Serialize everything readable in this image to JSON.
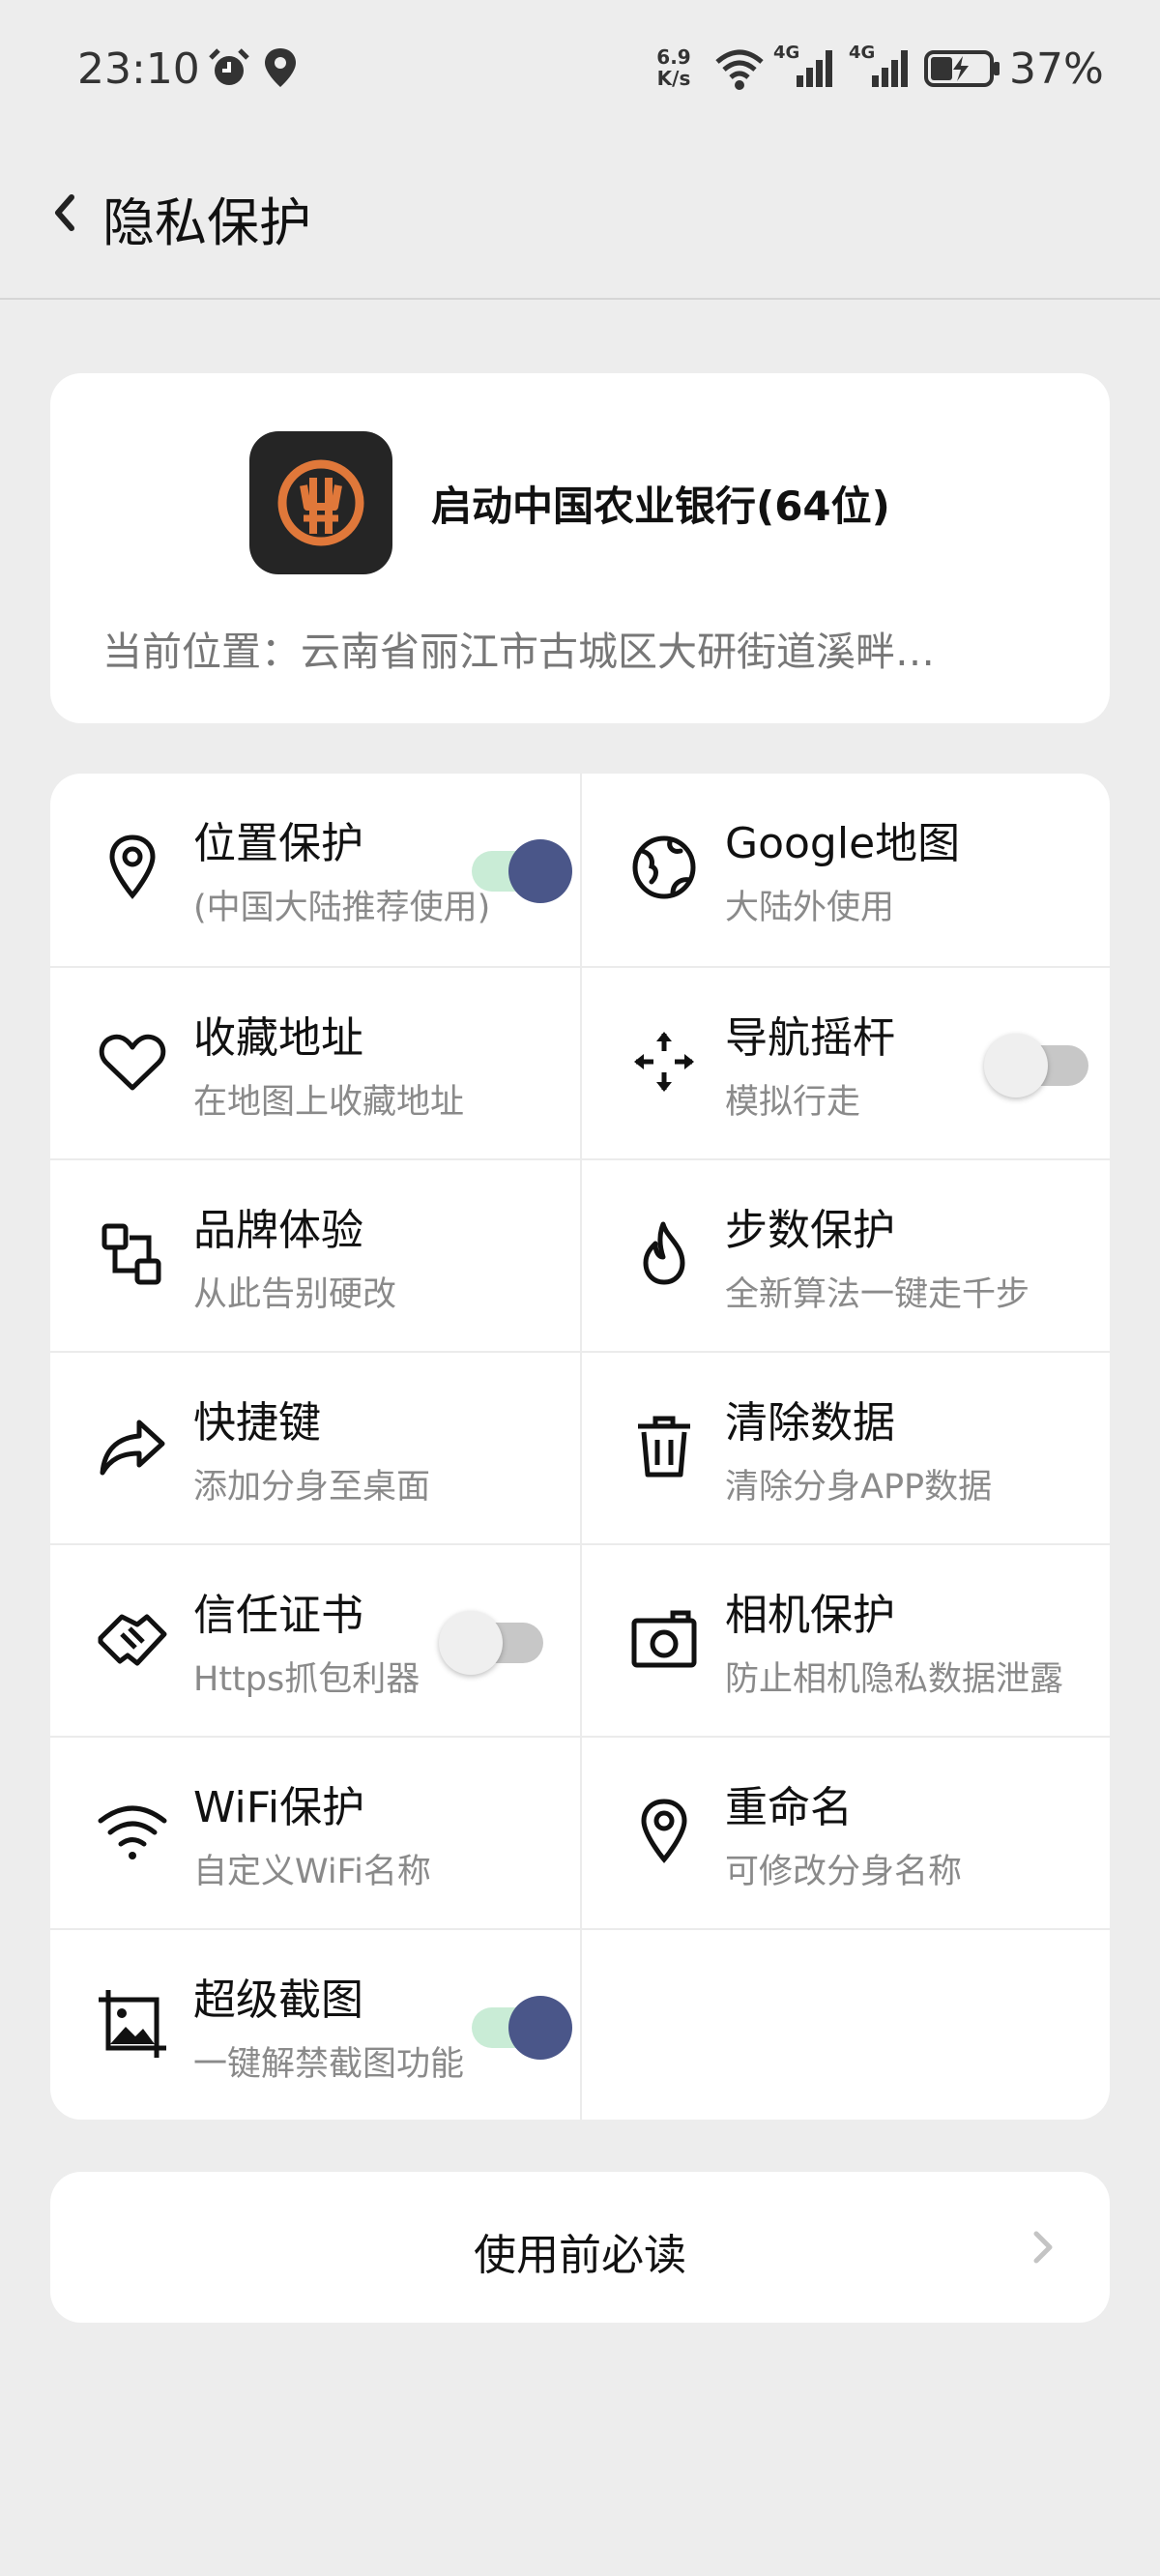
{
  "status_bar": {
    "time": "23:10",
    "net_speed_value": "6.9",
    "net_speed_unit": "K/s",
    "signal_1_label": "4G",
    "signal_2_label": "4G",
    "battery": "37%",
    "icons": [
      "alarm-icon",
      "location-icon",
      "wifi-icon",
      "signal-icon",
      "battery-icon"
    ]
  },
  "header": {
    "title": "隐私保护"
  },
  "app_card": {
    "app_name": "启动中国农业银行(64位)",
    "location_text": "当前位置：云南省丽江市古城区大研街道溪畔…"
  },
  "features": [
    {
      "title": "位置保护",
      "subtitle": "(中国大陆推荐使用)",
      "icon": "location-pin-icon",
      "toggle": "on"
    },
    {
      "title": "Google地图",
      "subtitle": "大陆外使用",
      "icon": "globe-icon"
    },
    {
      "title": "收藏地址",
      "subtitle": "在地图上收藏地址",
      "icon": "heart-icon"
    },
    {
      "title": "导航摇杆",
      "subtitle": "模拟行走",
      "icon": "move-arrows-icon",
      "toggle": "off"
    },
    {
      "title": "品牌体验",
      "subtitle": "从此告别硬改",
      "icon": "swap-boxes-icon"
    },
    {
      "title": "步数保护",
      "subtitle": "全新算法一键走千步",
      "icon": "flame-icon"
    },
    {
      "title": "快捷键",
      "subtitle": "添加分身至桌面",
      "icon": "share-arrow-icon"
    },
    {
      "title": "清除数据",
      "subtitle": "清除分身APP数据",
      "icon": "trash-icon"
    },
    {
      "title": "信任证书",
      "subtitle": "Https抓包利器",
      "icon": "handshake-icon",
      "toggle": "off"
    },
    {
      "title": "相机保护",
      "subtitle": "防止相机隐私数据泄露",
      "icon": "camera-icon"
    },
    {
      "title": "WiFi保护",
      "subtitle": "自定义WiFi名称",
      "icon": "wifi-icon"
    },
    {
      "title": "重命名",
      "subtitle": "可修改分身名称",
      "icon": "location-pin-icon"
    },
    {
      "title": "超级截图",
      "subtitle": "一键解禁截图功能",
      "icon": "screenshot-crop-icon",
      "toggle": "on"
    }
  ],
  "readme": {
    "label": "使用前必读"
  },
  "colors": {
    "background": "#ededed",
    "card": "#ffffff",
    "toggle_on_knob": "#4a5689",
    "toggle_on_track": "#c9ecd6",
    "toggle_off_track": "#c7c7c7",
    "app_icon_bg": "#252525",
    "app_icon_accent": "#e0783a"
  }
}
